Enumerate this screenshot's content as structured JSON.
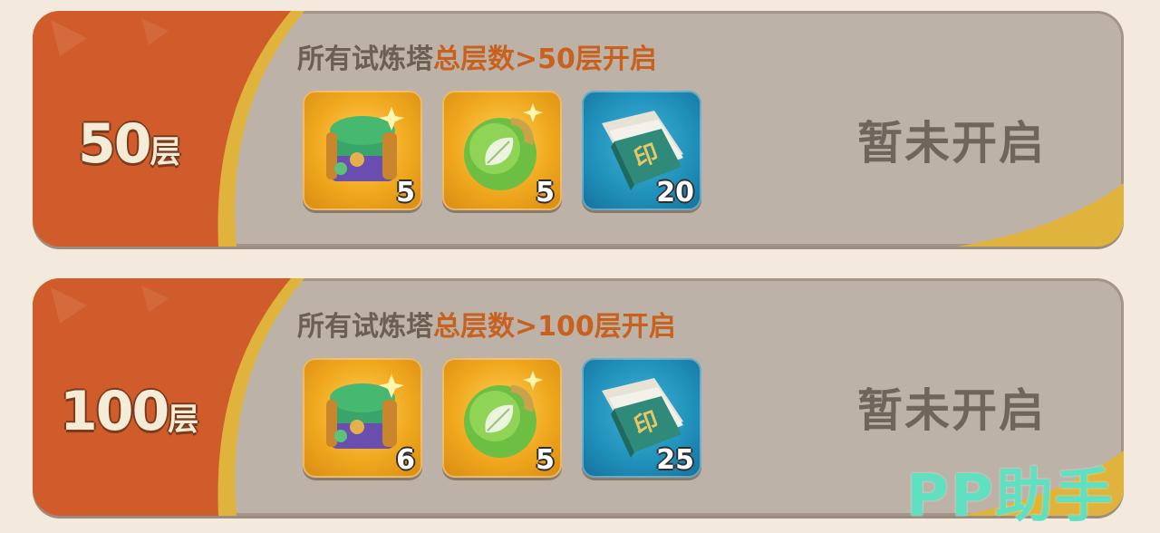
{
  "colors": {
    "card_bg": "#bdb2a8",
    "tier_orange": "#cf5c2a",
    "gold_swoosh": "#e0b43c",
    "condition_highlight": "#c8611d",
    "watermark": "#5fe0c0"
  },
  "tiers": [
    {
      "floor_number": "50",
      "floor_unit": "层",
      "condition_prefix": "所有试炼塔",
      "condition_highlight": "总层数>50层开启",
      "status": "暂未开启",
      "rewards": [
        {
          "icon": "treasure-chest-icon",
          "count": "5"
        },
        {
          "icon": "green-leaf-orb-icon",
          "count": "5"
        },
        {
          "icon": "rune-book-icon",
          "count": "20"
        }
      ]
    },
    {
      "floor_number": "100",
      "floor_unit": "层",
      "condition_prefix": "所有试炼塔",
      "condition_highlight": "总层数>100层开启",
      "status": "暂未开启",
      "rewards": [
        {
          "icon": "treasure-chest-icon",
          "count": "6"
        },
        {
          "icon": "green-leaf-orb-icon",
          "count": "5"
        },
        {
          "icon": "rune-book-icon",
          "count": "25"
        }
      ]
    }
  ],
  "watermark": "PP助手"
}
